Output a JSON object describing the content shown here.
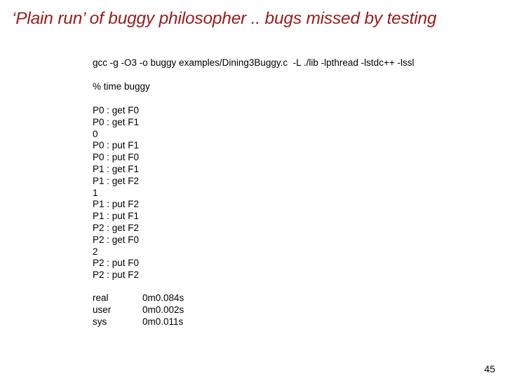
{
  "slide": {
    "title": "‘Plain run’ of buggy philosopher .. bugs missed by testing",
    "title_color": "#9b1b1b",
    "page_number": "45"
  },
  "terminal": {
    "compile_command": "gcc -g -O3 -o buggy examples/Dining3Buggy.c  -L ./lib -lpthread -lstdc++ -lssl",
    "run_command": "% time buggy",
    "output_lines": [
      "P0 : get F0",
      "P0 : get F1",
      "0",
      "P0 : put F1",
      "P0 : put F0",
      "P1 : get F1",
      "P1 : get F2",
      "1",
      "P1 : put F2",
      "P1 : put F1",
      "P2 : get F2",
      "P2 : get F0",
      "2",
      "P2 : put F0",
      "P2 : put F2"
    ],
    "timing": [
      {
        "label": "real",
        "value": "0m0.084s"
      },
      {
        "label": "user",
        "value": "0m0.002s"
      },
      {
        "label": "sys",
        "value": "0m0.011s"
      }
    ]
  }
}
